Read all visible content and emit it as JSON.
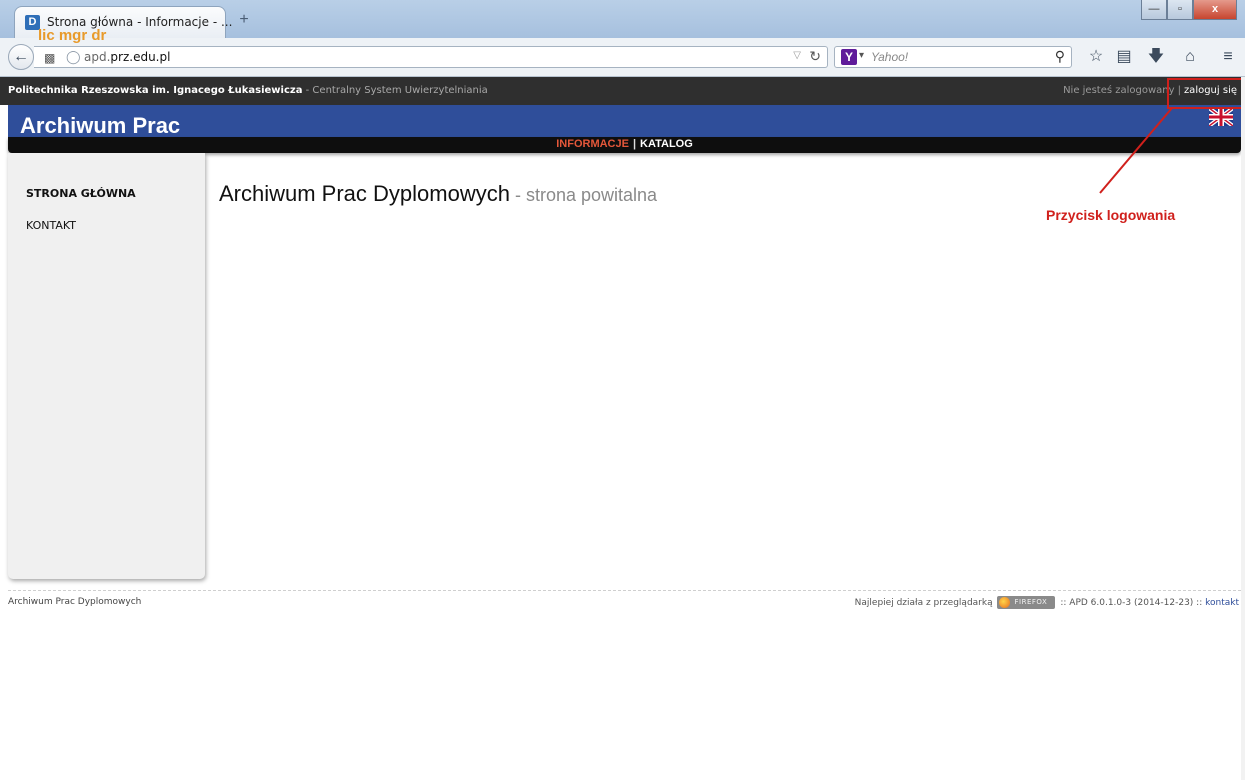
{
  "browser": {
    "tab_title": "Strona główna - Informacje - ...",
    "tab_favicon_letter": "D",
    "new_tab": "+",
    "url_prefix": "apd.",
    "url_domain": "prz.edu.pl",
    "search_placeholder": "Yahoo!",
    "search_engine_letter": "Y",
    "window_controls": {
      "minimize": "—",
      "maximize": "▫",
      "close": "x"
    },
    "icons": [
      "back-arrow-icon",
      "grid-icon",
      "globe-icon",
      "reload-icon",
      "yahoo-icon",
      "search-icon",
      "bookmark-star-icon",
      "reading-list-icon",
      "download-icon",
      "home-icon",
      "menu-icon"
    ]
  },
  "page": {
    "university_name": "Politechnika Rzeszowska im. Ignacego Łukasiewicza",
    "university_suffix": " - Centralny System Uwierzytelniania",
    "login_status": "Nie jesteś zalogowany",
    "login_separator": "|",
    "login_link": "zaloguj się",
    "app_title": "Archiwum Prac",
    "app_subtitle": "lic mgr dr",
    "menu": {
      "informacje": "INFORMACJE",
      "separator": "|",
      "katalog": "KATALOG"
    },
    "sidebar": {
      "items": [
        {
          "label": "STRONA GŁÓWNA"
        },
        {
          "label": "KONTAKT"
        }
      ]
    },
    "heading_main": "Archiwum Prac Dyplomowych",
    "heading_sub": " - strona powitalna",
    "footer": {
      "left": "Archiwum Prac Dyplomowych",
      "right_prefix": "Najlepiej działa z przeglądarką",
      "browser_badge": "FIREFOX",
      "right_version": ":: APD 6.0.1.0-3 (2014-12-23) ::",
      "contact_link": "kontakt"
    }
  },
  "annotation": {
    "label": "Przycisk logowania",
    "color": "#d0201c"
  },
  "colors": {
    "header_blue": "#2f4e9a",
    "menu_active": "#e4573a",
    "subtitle_orange": "#e89a2a"
  }
}
